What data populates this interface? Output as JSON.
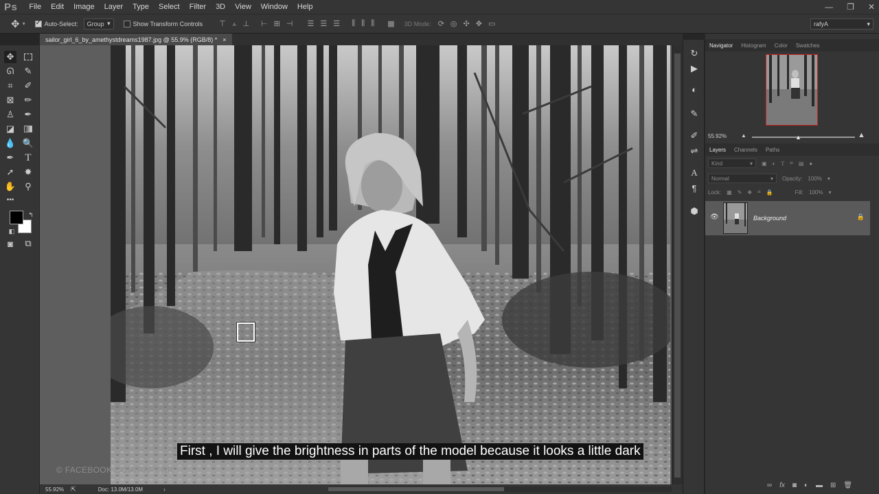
{
  "app": {
    "logo": "Ps"
  },
  "menu": [
    "File",
    "Edit",
    "Image",
    "Layer",
    "Type",
    "Select",
    "Filter",
    "3D",
    "View",
    "Window",
    "Help"
  ],
  "window_controls": {
    "minimize": "—",
    "restore": "❐",
    "close": "✕"
  },
  "options": {
    "auto_select_label": "Auto-Select:",
    "auto_select_checked": true,
    "group_value": "Group",
    "show_transform_label": "Show Transform Controls",
    "show_transform_checked": false,
    "mode_3d_label": "3D Mode:",
    "workspace_value": "rafyA"
  },
  "document": {
    "tab_title": "sailor_girl_6_by_amethystdreams1987.jpg @ 55.9% (RGB/8) *",
    "tab_close": "×"
  },
  "canvas": {
    "watermark": "© FACEBOOK.COM/RAFY.RR",
    "subtitle": "First , I will give the brightness in parts of the model because it looks a little dark"
  },
  "status": {
    "zoom": "55.92%",
    "doc_info": "Doc: 13.0M/13.0M"
  },
  "navigator": {
    "tabs": [
      "Navigator",
      "Histogram",
      "Color",
      "Swatches"
    ],
    "active_tab": "Navigator",
    "zoom": "55.92%"
  },
  "layers": {
    "tabs": [
      "Layers",
      "Channels",
      "Paths"
    ],
    "active_tab": "Layers",
    "filter_kind": "Kind",
    "blend_mode": "Normal",
    "opacity_label": "Opacity:",
    "opacity_value": "100%",
    "lock_label": "Lock:",
    "fill_label": "Fill:",
    "fill_value": "100%",
    "items": [
      {
        "name": "Background",
        "visible": true,
        "locked": true
      }
    ]
  },
  "colors": {
    "foreground": "#000000",
    "background": "#ffffff",
    "ui_bg": "#353535",
    "canvas_bg": "#5e5e5e"
  },
  "icons": {
    "move": "move-icon",
    "marquee": "rectangular-marquee-icon",
    "lasso": "lasso-icon",
    "quick_select": "quick-selection-icon",
    "crop": "crop-icon",
    "eyedropper": "eyedropper-icon",
    "heal": "healing-brush-icon",
    "brush": "brush-icon",
    "stamp": "clone-stamp-icon",
    "history_brush": "history-brush-icon",
    "eraser": "eraser-icon",
    "gradient": "gradient-icon",
    "blur": "blur-icon",
    "dodge": "dodge-icon",
    "pen": "pen-icon",
    "type": "type-icon",
    "path_select": "path-selection-icon",
    "shape": "custom-shape-icon",
    "hand": "hand-icon",
    "zoom": "zoom-icon",
    "more": "more-tools-icon"
  }
}
